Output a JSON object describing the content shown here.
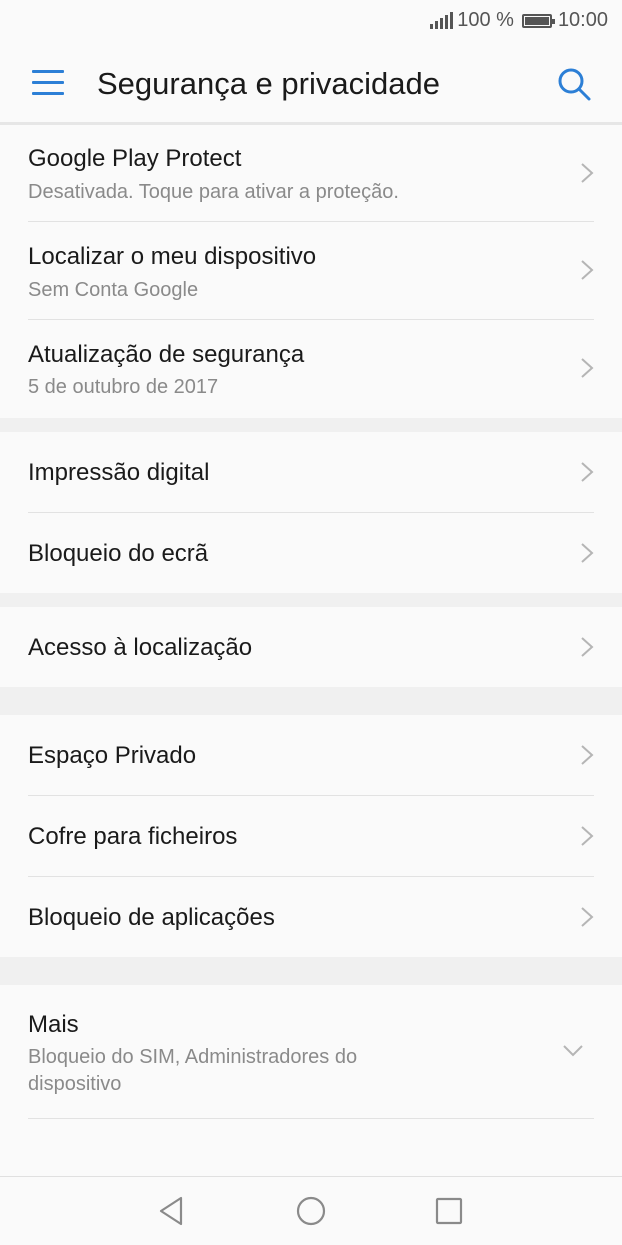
{
  "status_bar": {
    "battery": "100 %",
    "time": "10:00",
    "signal_icon": "signal-icon",
    "battery_icon": "battery-icon"
  },
  "app_bar": {
    "title": "Segurança e privacidade",
    "menu_icon": "hamburger-menu-icon",
    "search_icon": "search-icon",
    "accent_color": "#2c7fd6"
  },
  "groups": [
    {
      "items": [
        {
          "label": "Google Play Protect",
          "subtitle": "Desativada. Toque para ativar a proteção."
        },
        {
          "label": "Localizar o meu dispositivo",
          "subtitle": "Sem Conta Google"
        },
        {
          "label": "Atualização de segurança",
          "subtitle": "5 de outubro de 2017"
        }
      ]
    },
    {
      "items": [
        {
          "label": "Impressão digital"
        },
        {
          "label": "Bloqueio do ecrã"
        }
      ]
    },
    {
      "items": [
        {
          "label": "Acesso à localização"
        }
      ]
    },
    {
      "items": [
        {
          "label": "Espaço Privado"
        },
        {
          "label": "Cofre para ficheiros"
        },
        {
          "label": "Bloqueio de aplicações"
        }
      ]
    },
    {
      "items": [
        {
          "label": "Mais",
          "subtitle_line1": "Bloqueio do SIM, Administradores do",
          "subtitle_line2": "dispositivo"
        }
      ]
    }
  ],
  "nav_bar": {
    "back_icon": "back-triangle-icon",
    "home_icon": "home-circle-icon",
    "recents_icon": "recents-square-icon"
  }
}
